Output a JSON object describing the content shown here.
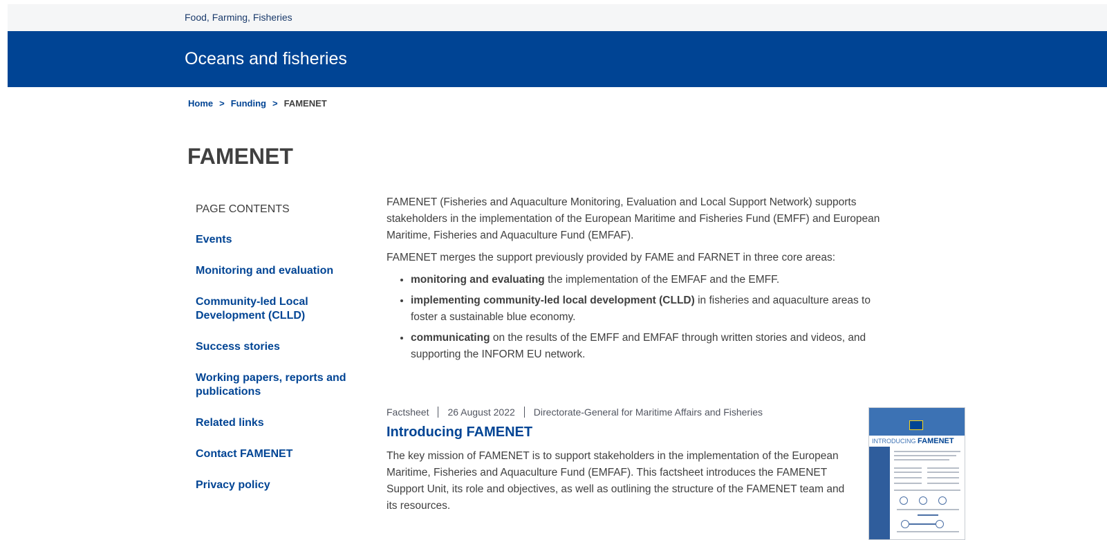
{
  "top_bar": {
    "site_name": "Food, Farming, Fisheries"
  },
  "banner": {
    "title": "Oceans and fisheries"
  },
  "breadcrumb": {
    "items": [
      "Home",
      "Funding"
    ],
    "current": "FAMENET",
    "separator": ">"
  },
  "page": {
    "title": "FAMENET"
  },
  "toc": {
    "heading": "PAGE CONTENTS",
    "items": [
      "Events",
      "Monitoring and evaluation",
      "Community-led Local Development (CLLD)",
      "Success stories",
      "Working papers, reports and publications",
      "Related links",
      "Contact FAMENET",
      "Privacy policy"
    ]
  },
  "content": {
    "intro": "FAMENET (Fisheries and Aquaculture Monitoring, Evaluation and Local Support Network) supports stakeholders in the implementation of the European Maritime and Fisheries Fund (EMFF) and European Maritime, Fisheries and Aquaculture Fund (EMFAF).",
    "merges": "FAMENET merges the support previously provided by FAME and FARNET in three core areas:",
    "bullets": [
      {
        "bold": "monitoring and evaluating",
        "text": " the implementation of the EMFAF and the EMFF."
      },
      {
        "bold": "implementing community-led local development (CLLD)",
        "text": " in fisheries and aquaculture areas to foster a sustainable blue economy."
      },
      {
        "bold": "communicating",
        "text": " on the results of the EMFF and EMFAF through written stories and videos, and supporting the INFORM EU network."
      }
    ]
  },
  "factsheet": {
    "type": "Factsheet",
    "date": "26 August 2022",
    "author": "Directorate-General for Maritime Affairs and Fisheries",
    "title": "Introducing FAMENET",
    "description": "The key mission of FAMENET is to support stakeholders in the implementation of the European Maritime, Fisheries and Aquaculture Fund (EMFAF). This factsheet introduces the FAMENET Support Unit, its role and objectives, as well as outlining the structure of the FAMENET team and its resources.",
    "thumbnail": {
      "prefix": "INTRODUCING",
      "name": "FAMENET"
    }
  },
  "colors": {
    "brand_blue": "#004494",
    "top_strip": "#f5f6f7",
    "text": "#404040"
  }
}
